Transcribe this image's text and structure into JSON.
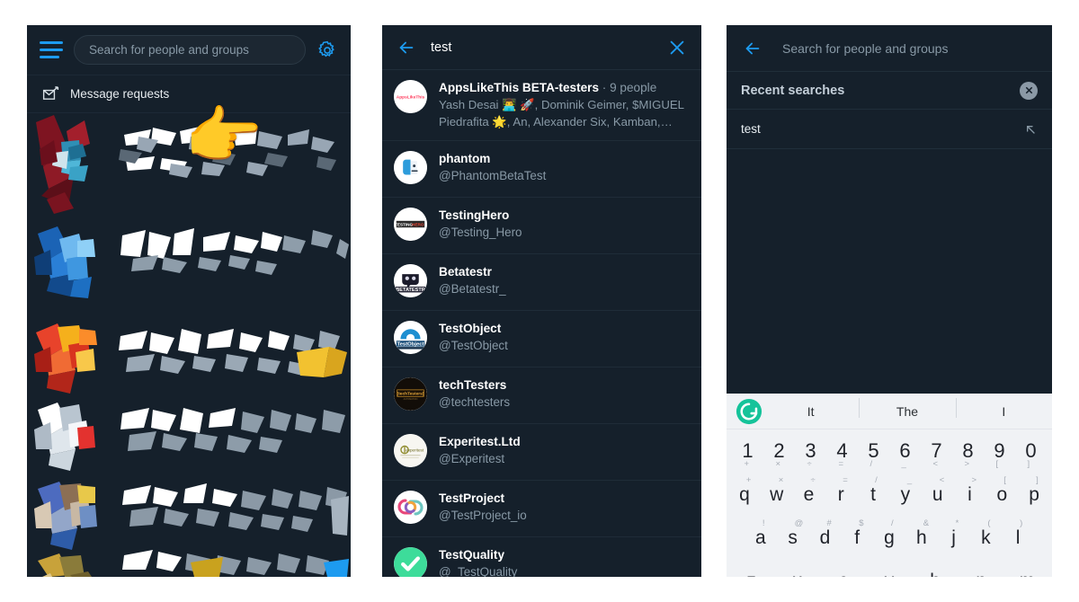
{
  "left_panel": {
    "menu_icon": "hamburger-menu-icon",
    "search_placeholder": "Search for people and groups",
    "settings_icon": "gear-icon",
    "message_requests_label": "Message requests",
    "message_requests_icon": "envelope-arrow-icon",
    "cursor_icon": "pointing-hand-cursor",
    "content_note": "chat list shattering into polygon fragments"
  },
  "middle_panel": {
    "back_icon": "back-arrow-icon",
    "clear_icon": "close-x-icon",
    "query": "test",
    "results": [
      {
        "name": "AppsLikeThis BETA-testers",
        "separator": " · ",
        "meta": "9 people",
        "members": "Yash Desai 👨‍💻 🚀, Dominik Geimer, $MIGUEL Piedrafita 🌟, An, Alexander Six, Kamban, Sli…",
        "avatar": "appslikethis-logo",
        "avatar_text": "AppsLikeThis"
      },
      {
        "name": "phantom",
        "handle": "@PhantomBetaTest",
        "avatar": "phantom-logo"
      },
      {
        "name": "TestingHero",
        "handle": "@Testing_Hero",
        "avatar": "testinghero-logo",
        "avatar_text": "TESTINGHERO"
      },
      {
        "name": "Betatestr",
        "handle": "@Betatestr_",
        "avatar": "betatestr-logo",
        "avatar_text": "BETATESTR"
      },
      {
        "name": "TestObject",
        "handle": "@TestObject",
        "avatar": "testobject-logo",
        "avatar_text": "TestObject"
      },
      {
        "name": "techTesters",
        "handle": "@techtesters",
        "avatar": "techtesters-logo",
        "avatar_text": "[techTesters]"
      },
      {
        "name": "Experitest.Ltd",
        "handle": "@Experitest",
        "avatar": "experitest-logo",
        "avatar_text": "experitest"
      },
      {
        "name": "TestProject",
        "handle": "@TestProject_io",
        "avatar": "testproject-logo"
      },
      {
        "name": "TestQuality",
        "handle": "@_TestQuality",
        "avatar": "testquality-logo"
      }
    ]
  },
  "right_panel": {
    "back_icon": "back-arrow-icon",
    "search_placeholder": "Search for people and groups",
    "recent_title": "Recent searches",
    "clear_all_icon": "clear-all-x-icon",
    "recent_items": [
      {
        "text": "test",
        "action_icon": "insert-arrow-icon"
      }
    ],
    "keyboard": {
      "assistant_icon": "grammarly-icon",
      "suggestions": [
        "It",
        "The",
        "I"
      ],
      "rows": [
        [
          {
            "main": "1",
            "sup": "+"
          },
          {
            "main": "2",
            "sup": "×"
          },
          {
            "main": "3",
            "sup": "÷"
          },
          {
            "main": "4",
            "sup": "="
          },
          {
            "main": "5",
            "sup": "/"
          },
          {
            "main": "6",
            "sup": "_"
          },
          {
            "main": "7",
            "sup": "<"
          },
          {
            "main": "8",
            "sup": ">"
          },
          {
            "main": "9",
            "sup": "["
          },
          {
            "main": "0",
            "sup": "]"
          }
        ],
        [
          {
            "main": "q",
            "sup": "+"
          },
          {
            "main": "w",
            "sup": "×"
          },
          {
            "main": "e",
            "sup": "÷"
          },
          {
            "main": "r",
            "sup": "="
          },
          {
            "main": "t",
            "sup": "/"
          },
          {
            "main": "y",
            "sup": "_"
          },
          {
            "main": "u",
            "sup": "<"
          },
          {
            "main": "i",
            "sup": ">"
          },
          {
            "main": "o",
            "sup": "["
          },
          {
            "main": "p",
            "sup": "]"
          }
        ],
        [
          {
            "main": "a",
            "sup": "!"
          },
          {
            "main": "s",
            "sup": "@"
          },
          {
            "main": "d",
            "sup": "#"
          },
          {
            "main": "f",
            "sup": "$"
          },
          {
            "main": "g",
            "sup": "/"
          },
          {
            "main": "h",
            "sup": "&"
          },
          {
            "main": "j",
            "sup": "*"
          },
          {
            "main": "k",
            "sup": "("
          },
          {
            "main": "l",
            "sup": ")"
          }
        ],
        [
          {
            "main": "z",
            "sup": ""
          },
          {
            "main": "x",
            "sup": ""
          },
          {
            "main": "c",
            "sup": ""
          },
          {
            "main": "v",
            "sup": ""
          },
          {
            "main": "b",
            "sup": ""
          },
          {
            "main": "n",
            "sup": ""
          },
          {
            "main": "m",
            "sup": ""
          }
        ]
      ]
    }
  },
  "colors": {
    "app_background": "#15202b",
    "accent_blue": "#1d9bf0",
    "secondary_text": "#8899a6",
    "primary_text": "#ffffff",
    "divider": "#1f2c38",
    "keyboard_background": "#f0f2f5",
    "grammarly_green": "#15c39a",
    "page_background": "#ffffff"
  }
}
